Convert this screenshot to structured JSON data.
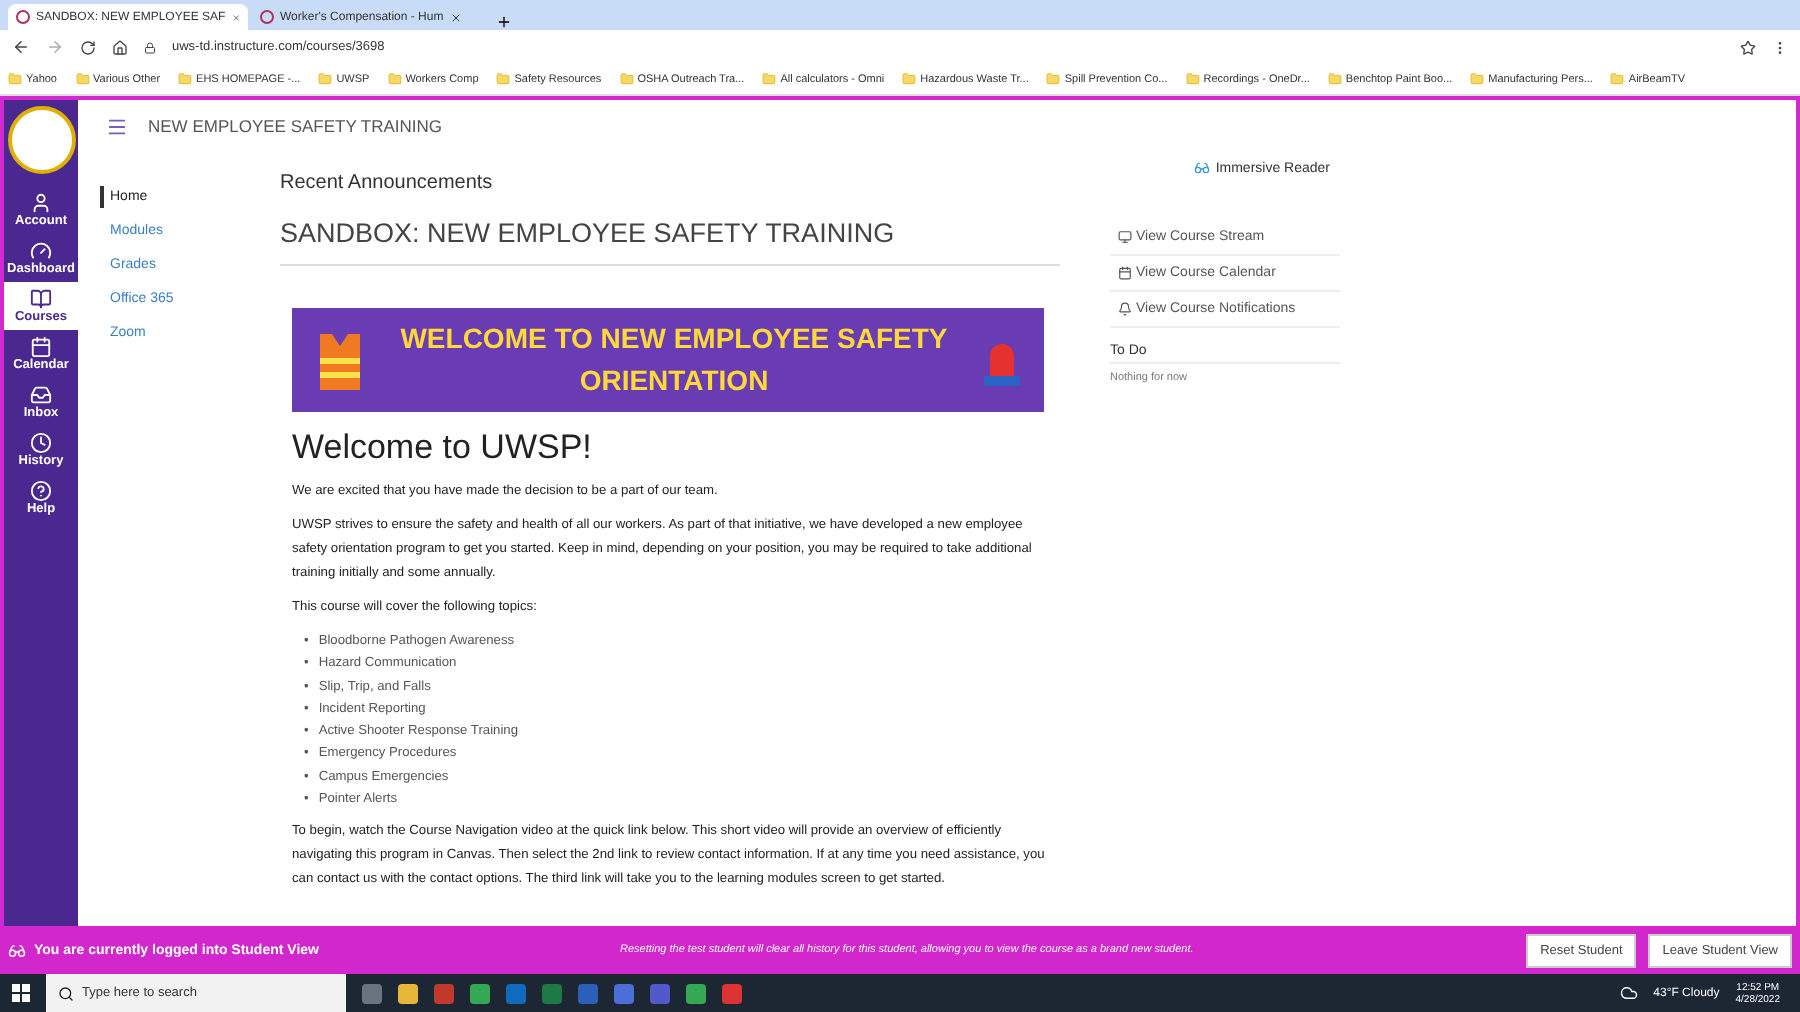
{
  "browser": {
    "tabs": [
      {
        "title": "SANDBOX: NEW EMPLOYEE SAF",
        "selected": true
      },
      {
        "title": "Worker's Compensation - Hum",
        "selected": false
      }
    ],
    "url": "uws-td.instructure.com/courses/3698",
    "bookmarks": [
      "Yahoo",
      "Various Other",
      "EHS HOMEPAGE -...",
      "UWSP",
      "Workers Comp",
      "Safety Resources",
      "OSHA Outreach Tra...",
      "All calculators - Omni",
      "Hazardous Waste Tr...",
      "Spill Prevention Co...",
      "Recordings - OneDr...",
      "Benchtop Paint Boo...",
      "Manufacturing Pers...",
      "AirBeamTV"
    ]
  },
  "global_nav": [
    {
      "label": "Account",
      "selected": false
    },
    {
      "label": "Dashboard",
      "selected": false
    },
    {
      "label": "Courses",
      "selected": true
    },
    {
      "label": "Calendar",
      "selected": false
    },
    {
      "label": "Inbox",
      "selected": false
    },
    {
      "label": "History",
      "selected": false
    },
    {
      "label": "Help",
      "selected": false
    }
  ],
  "course": {
    "title": "NEW EMPLOYEE SAFETY TRAINING",
    "nav": [
      {
        "label": "Home",
        "selected": true
      },
      {
        "label": "Modules",
        "selected": false
      },
      {
        "label": "Grades",
        "selected": false
      },
      {
        "label": "Office 365",
        "selected": false
      },
      {
        "label": "Zoom",
        "selected": false
      }
    ]
  },
  "content": {
    "section_title": "Recent Announcements",
    "page_title": "SANDBOX: NEW EMPLOYEE SAFETY TRAINING",
    "banner": "WELCOME TO NEW EMPLOYEE SAFETY ORIENTATION",
    "heading": "Welcome to UWSP!",
    "blocks": [
      {
        "kind": "paragraph",
        "text": "We are excited that you have made the decision to be a part of our team."
      },
      {
        "kind": "paragraph",
        "text": "UWSP strives to ensure the safety and health of all our workers.  As part of that initiative, we have developed a new employee safety orientation program to get you started.  Keep in mind, depending on your position, you may be required to take additional training initially and some annually."
      },
      {
        "kind": "paragraph",
        "text": "This course will cover the following topics:"
      },
      {
        "kind": "list",
        "marker": "•",
        "items": [
          "Bloodborne Pathogen Awareness",
          "Hazard Communication",
          "Slip, Trip, and Falls",
          "Incident Reporting",
          "Active Shooter Response Training",
          "Emergency Procedures",
          "Campus Emergencies",
          "Pointer Alerts"
        ]
      },
      {
        "kind": "paragraph",
        "text": "To begin,  watch the Course Navigation video at the quick link below.  This short video will provide an overview of efficiently navigating this program in Canvas.  Then select the 2nd link to review contact information.  If at any time you need assistance, you can contact us with the contact options.  The third link will take you to the learning modules screen to get started."
      }
    ]
  },
  "sidebar": {
    "immersive_reader": "Immersive Reader",
    "links": [
      {
        "kind": "stream",
        "label": "View Course Stream"
      },
      {
        "kind": "calendar",
        "label": "View Course Calendar"
      },
      {
        "kind": "notifications",
        "label": "View Course Notifications"
      }
    ],
    "todo_title": "To Do",
    "todo_empty": "Nothing for now"
  },
  "student_bar": {
    "message": "You are currently logged into Student View",
    "note": "Resetting the test student will clear all history for this student, allowing you to view the course as a brand new student.",
    "buttons": [
      "Reset Student",
      "Leave Student View"
    ]
  },
  "taskbar": {
    "search_placeholder": "Type here to search",
    "weather": "43°F  Cloudy",
    "time": "12:52 PM",
    "date": "4/28/2022"
  }
}
